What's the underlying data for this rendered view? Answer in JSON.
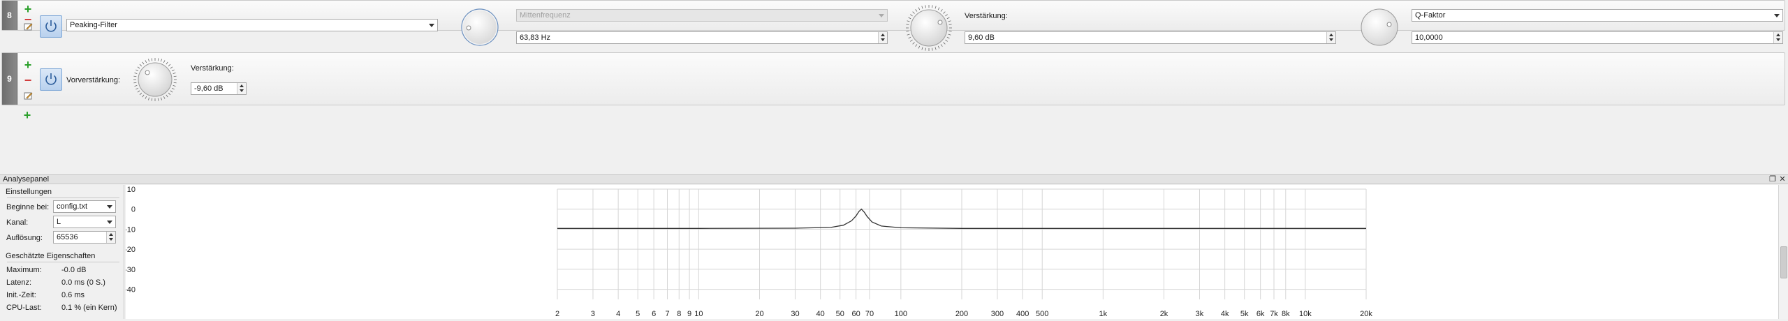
{
  "filters": [
    {
      "number": "8",
      "type_value": "Peaking-Filter",
      "freq_label": "Mittenfrequenz",
      "freq_value": "63,83 Hz",
      "gain_label": "Verstärkung:",
      "gain_value": "9,60 dB",
      "q_label": "Q-Faktor",
      "q_value": "10,0000"
    },
    {
      "number": "9",
      "preamp_label": "Vorverstärkung:",
      "gain_label": "Verstärkung:",
      "gain_value": "-9,60 dB"
    }
  ],
  "analysis": {
    "title": "Analysepanel",
    "settings_header": "Einstellungen",
    "start_label": "Beginne bei:",
    "start_value": "config.txt",
    "channel_label": "Kanal:",
    "channel_value": "L",
    "resolution_label": "Auflösung:",
    "resolution_value": "65536",
    "props_header": "Geschätzte Eigenschaften",
    "max_label": "Maximum:",
    "max_value": "-0.0 dB",
    "latency_label": "Latenz:",
    "latency_value": "0.0 ms (0 S.)",
    "init_label": "Init.-Zeit:",
    "init_value": "0.6 ms",
    "cpu_label": "CPU-Last:",
    "cpu_value": "0.1 % (ein Kern)"
  },
  "chart_data": {
    "type": "line",
    "xscale": "log",
    "xlim": [
      2,
      20000
    ],
    "ylim": [
      -45,
      10
    ],
    "yticks": [
      10,
      0,
      -10,
      -20,
      -30,
      -40
    ],
    "xtick_labels": [
      "2",
      "3",
      "4",
      "5",
      "6",
      "7",
      "8",
      "9",
      "10",
      "20",
      "30",
      "40",
      "50",
      "60",
      "70",
      "100",
      "200",
      "300",
      "400",
      "500",
      "1k",
      "2k",
      "3k",
      "4k",
      "5k",
      "6k",
      "7k",
      "8k",
      "10k",
      "20k"
    ],
    "xtick_values": [
      2,
      3,
      4,
      5,
      6,
      7,
      8,
      9,
      10,
      20,
      30,
      40,
      50,
      60,
      70,
      100,
      200,
      300,
      400,
      500,
      1000,
      2000,
      3000,
      4000,
      5000,
      6000,
      7000,
      8000,
      10000,
      20000
    ],
    "series": [
      {
        "x": [
          2,
          10,
          30,
          45,
          52,
          57,
          60,
          62,
          63.83,
          66,
          68,
          72,
          80,
          100,
          200,
          1000,
          20000
        ],
        "y": [
          -9.6,
          -9.6,
          -9.5,
          -9.1,
          -8.0,
          -5.8,
          -3.4,
          -1.2,
          0,
          -1.6,
          -3.6,
          -6.4,
          -8.4,
          -9.3,
          -9.6,
          -9.6,
          -9.6
        ]
      }
    ],
    "grid": true,
    "colors": {
      "line": "#333333",
      "grid": "#d6d6d6"
    }
  }
}
